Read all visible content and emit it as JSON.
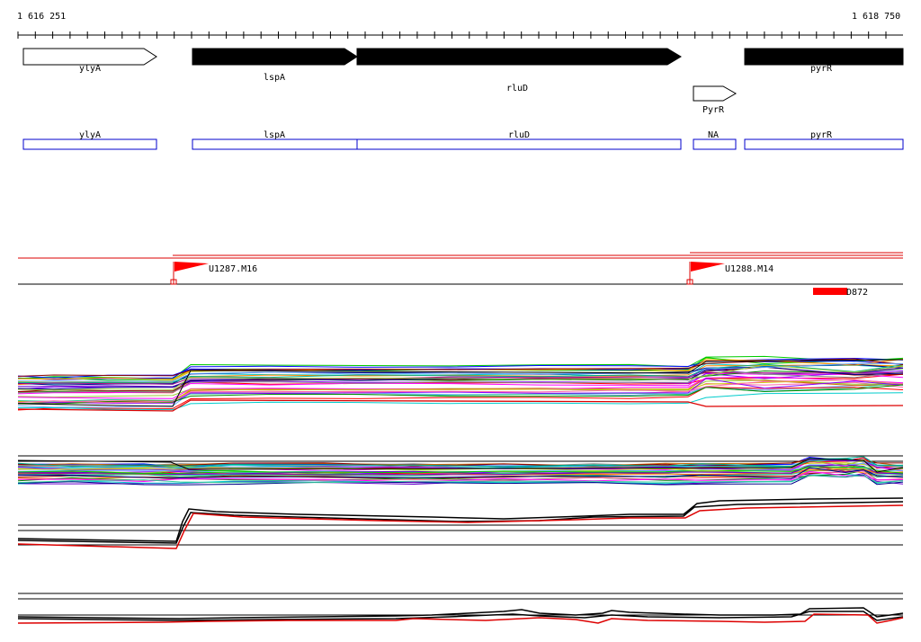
{
  "coordinates": {
    "start": "1 616 251",
    "end": "1 618 750"
  },
  "genes": [
    {
      "name": "ylyA",
      "strand": "forward",
      "style": "outline"
    },
    {
      "name": "lspA",
      "strand": "forward",
      "style": "filled"
    },
    {
      "name": "rluD",
      "strand": "forward",
      "style": "filled"
    },
    {
      "name": "PyrR",
      "strand": "forward",
      "style": "outline"
    },
    {
      "name": "pyrR",
      "strand": "forward",
      "style": "filled"
    }
  ],
  "gene_boxes": [
    "ylyA",
    "lspA",
    "rluD",
    "NA",
    "pyrR"
  ],
  "markers": [
    {
      "label": "U1287.M16"
    },
    {
      "label": "U1288.M14"
    }
  ],
  "feature_label": "D872",
  "colors": {
    "gene_box_border": "#0000cc",
    "marker": "#ff0000",
    "trace_dark": "#000000",
    "trace_red": "#dd0000",
    "axis": "#000000"
  }
}
